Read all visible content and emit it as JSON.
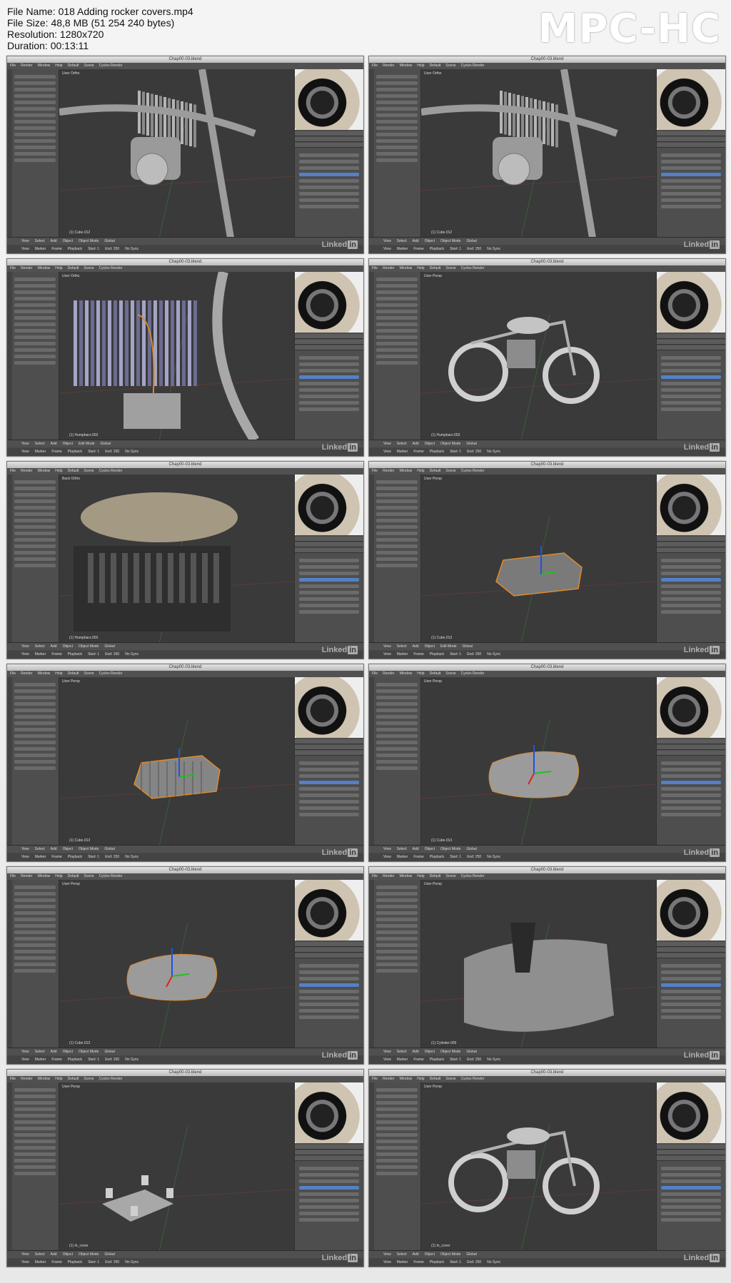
{
  "file_info": {
    "file_name": "File Name: 018 Adding rocker covers.mp4",
    "file_size": "File Size: 48,8 MB (51 254 240 bytes)",
    "resolution": "Resolution: 1280x720",
    "duration": "Duration: 00:13:11"
  },
  "brand": "MPC-HC",
  "blender": {
    "window_title": "Chap00-03.blend",
    "menu": [
      "File",
      "Render",
      "Window",
      "Help",
      "Default",
      "Scene",
      "Cycles Render"
    ],
    "header_menu": [
      "View",
      "Select",
      "Add",
      "Object",
      "Object Mode",
      "Global"
    ],
    "timeline_menu": [
      "View",
      "Marker",
      "Frame",
      "Playback",
      "Start: 1",
      "End: 250",
      "No Sync"
    ],
    "watermark_text": "Linked",
    "watermark_in": "in"
  },
  "thumbnails": [
    {
      "view": "User Ortho",
      "object": "(1) Cube.012",
      "mode": "Object Mode",
      "scene": "engine"
    },
    {
      "view": "User Ortho",
      "object": "(1) Cube.012",
      "mode": "Object Mode",
      "scene": "engine"
    },
    {
      "view": "User Ortho",
      "object": "(1) Humpbars.003",
      "mode": "Edit Mode",
      "scene": "curve"
    },
    {
      "view": "User Persp",
      "object": "(1) Humpbars.003",
      "mode": "Object Mode",
      "scene": "bike"
    },
    {
      "view": "Back Ortho",
      "object": "(1) Humpbars.003",
      "mode": "Object Mode",
      "scene": "tank"
    },
    {
      "view": "User Persp",
      "object": "(1) Cube.013",
      "mode": "Edit Mode",
      "scene": "box"
    },
    {
      "view": "User Persp",
      "object": "(1) Cube.013",
      "mode": "Object Mode",
      "scene": "boxgrid"
    },
    {
      "view": "User Persp",
      "object": "(1) Cube.013",
      "mode": "Object Mode",
      "scene": "cover"
    },
    {
      "view": "User Persp",
      "object": "(1) Cube.013",
      "mode": "Object Mode",
      "scene": "cover"
    },
    {
      "view": "User Persp",
      "object": "(1) Cylinder.009",
      "mode": "Object Mode",
      "scene": "bolt"
    },
    {
      "view": "User Persp",
      "object": "(1) rk_cover",
      "mode": "Object Mode",
      "scene": "smallbox"
    },
    {
      "view": "User Persp",
      "object": "(1) rk_cover",
      "mode": "Object Mode",
      "scene": "bike"
    }
  ]
}
